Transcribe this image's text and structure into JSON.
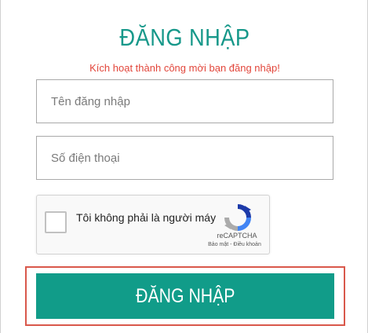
{
  "form": {
    "title": "ĐĂNG NHẬP",
    "message": "Kích hoạt thành công mời bạn đăng nhập!",
    "username_placeholder": "Tên đăng nhập",
    "phone_placeholder": "Số điện thoại",
    "submit_label": "ĐĂNG NHẬP"
  },
  "captcha": {
    "label": "Tôi không phải là người máy",
    "brand": "reCAPTCHA",
    "links": "Bảo mật - Điều khoản",
    "icon": "recaptcha-logo-icon"
  },
  "colors": {
    "accent": "#17988a",
    "button": "#119c89",
    "message": "#e2463b",
    "highlight": "#d9584b"
  }
}
